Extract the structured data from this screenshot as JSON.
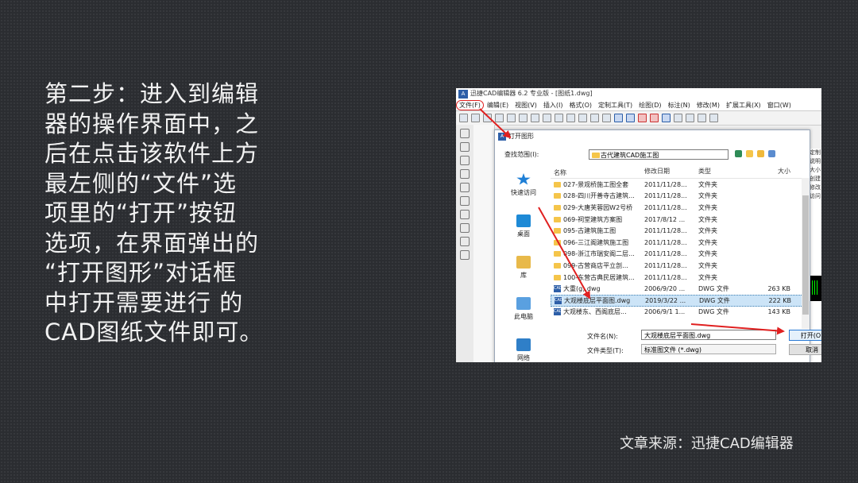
{
  "slide": {
    "text_lines": [
      "第二步：进入到编辑",
      "器的操作界面中，之",
      "后在点击该软件上方",
      "最左侧的“文件”选",
      "项里的“打开”按钮",
      "选项，在界面弹出的",
      "“打开图形”对话框",
      "中打开需要进行 的",
      "CAD图纸文件即可。"
    ],
    "source": "文章来源：迅捷CAD编辑器"
  },
  "app": {
    "logo": "A",
    "title": "迅捷CAD编辑器 6.2 专业版 - [图纸1.dwg]",
    "menu": [
      "文件(F)",
      "编辑(E)",
      "视图(V)",
      "插入(I)",
      "格式(O)",
      "定制工具(T)",
      "绘图(D)",
      "标注(N)",
      "修改(M)",
      "扩展工具(X)",
      "窗口(W)"
    ],
    "right_panel": [
      "定制",
      "说明",
      "大小",
      "创建",
      "修改",
      "访问"
    ]
  },
  "dialog": {
    "title": "打开图形",
    "look_in_label": "查找范围(I):",
    "look_in_value": "古代建筑CAD施工图",
    "places": [
      "快速访问",
      "桌面",
      "库",
      "此电脑",
      "网络"
    ],
    "columns": [
      "名称",
      "修改日期",
      "类型",
      "大小"
    ],
    "files": [
      {
        "name": "027-景观桥施工图全套",
        "date": "2011/11/28...",
        "type": "文件夹",
        "size": "",
        "kind": "folder"
      },
      {
        "name": "028-四川开善寺古建筑...",
        "date": "2011/11/28...",
        "type": "文件夹",
        "size": "",
        "kind": "folder"
      },
      {
        "name": "029-大唐芙蓉园W2号桥",
        "date": "2011/11/28...",
        "type": "文件夹",
        "size": "",
        "kind": "folder"
      },
      {
        "name": "069-祠堂建筑方案图",
        "date": "2017/8/12 ...",
        "type": "文件夹",
        "size": "",
        "kind": "folder"
      },
      {
        "name": "095-古建筑施工图",
        "date": "2011/11/28...",
        "type": "文件夹",
        "size": "",
        "kind": "folder"
      },
      {
        "name": "096-三江阁建筑施工图",
        "date": "2011/11/28...",
        "type": "文件夹",
        "size": "",
        "kind": "folder"
      },
      {
        "name": "098-浙江市瑞安阁二层...",
        "date": "2011/11/28...",
        "type": "文件夹",
        "size": "",
        "kind": "folder"
      },
      {
        "name": "099-古营商店平立剖...",
        "date": "2011/11/28...",
        "type": "文件夹",
        "size": "",
        "kind": "folder"
      },
      {
        "name": "100-东营古典民居建筑...",
        "date": "2011/11/28...",
        "type": "文件夹",
        "size": "",
        "kind": "folder"
      },
      {
        "name": "大重(g).dwg",
        "date": "2006/9/20 ...",
        "type": "DWG 文件",
        "size": "263 KB",
        "kind": "dwg"
      },
      {
        "name": "大观楼底层平面图.dwg",
        "date": "2019/3/22 ...",
        "type": "DWG 文件",
        "size": "222 KB",
        "kind": "dwg",
        "selected": true
      },
      {
        "name": "大观楼东、西阁底层...",
        "date": "2006/9/1 1...",
        "type": "DWG 文件",
        "size": "143 KB",
        "kind": "dwg"
      }
    ],
    "filename_label": "文件名(N):",
    "filename_value": "大观楼底层平面图.dwg",
    "filetype_label": "文件类型(T):",
    "filetype_value": "标准图文件 (*.dwg)",
    "open_button": "打开(O)",
    "cancel_button": "取消"
  },
  "colors": {
    "annotation": "#e02020",
    "selection": "#cce4f7",
    "accent": "#2d5fa8"
  }
}
